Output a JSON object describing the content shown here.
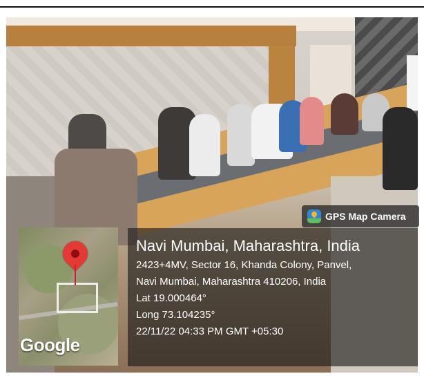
{
  "overlay": {
    "badge_label": "GPS Map Camera",
    "map_brand": "Google",
    "city": "Navi Mumbai, Maharashtra, India",
    "address_line1": "2423+4MV, Sector 16, Khanda Colony, Panvel,",
    "address_line2": "Navi Mumbai, Maharashtra 410206, India",
    "lat": "Lat 19.000464°",
    "long": "Long 73.104235°",
    "datetime": "22/11/22 04:33 PM GMT +05:30"
  },
  "icons": {
    "badge": "gps-map-camera-icon",
    "pin": "map-pin-icon"
  },
  "colors": {
    "pin": "#e53935",
    "badge_bg": "#2f86d6"
  }
}
